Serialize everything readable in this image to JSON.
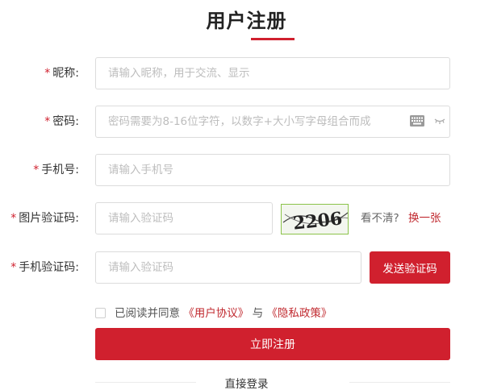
{
  "page": {
    "title": "用户注册"
  },
  "form": {
    "required_mark": "*",
    "nickname": {
      "label": "昵称:",
      "placeholder": "请输入昵称，用于交流、显示"
    },
    "password": {
      "label": "密码:",
      "placeholder": "密码需要为8-16位字符，以数字+大小写字母组合而成"
    },
    "phone": {
      "label": "手机号:",
      "placeholder": "请输入手机号"
    },
    "captcha": {
      "label": "图片验证码:",
      "placeholder": "请输入验证码",
      "image_text": "2206",
      "cant_see": "看不清?",
      "refresh": "换一张"
    },
    "sms": {
      "label": "手机验证码:",
      "placeholder": "请输入验证码",
      "send_button": "发送验证码"
    }
  },
  "agreement": {
    "prefix": "已阅读并同意",
    "user_agreement": "《用户协议》",
    "and": "与",
    "privacy_policy": "《隐私政策》"
  },
  "submit_label": "立即注册",
  "login_link": "直接登录",
  "colors": {
    "brand_red": "#d0202e",
    "link_red": "#c0282e",
    "border": "#dcdcdc"
  },
  "icons": {
    "keyboard": "keyboard-icon",
    "eye": "eye-hidden-icon"
  }
}
